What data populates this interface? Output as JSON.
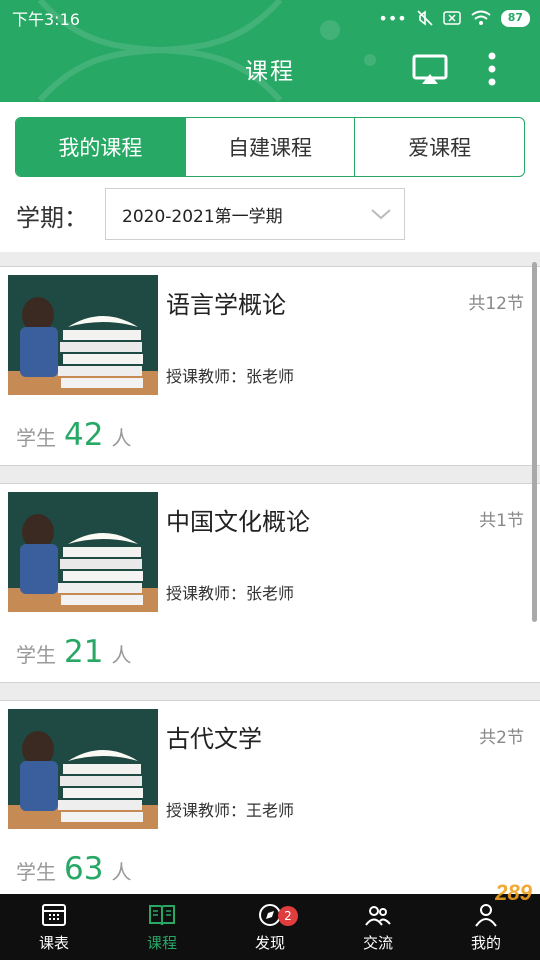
{
  "status_bar": {
    "time": "下午3:16",
    "battery": "87"
  },
  "header": {
    "title": "课程"
  },
  "segments": [
    "我的课程",
    "自建课程",
    "爱课程"
  ],
  "term": {
    "label": "学期：",
    "selected": "2020-2021第一学期"
  },
  "students_label": "学生",
  "students_unit": "人",
  "courses": [
    {
      "name": "语言学概论",
      "sections": "共12节",
      "teacher": "授课教师：张老师",
      "students": "42"
    },
    {
      "name": "中国文化概论",
      "sections": "共1节",
      "teacher": "授课教师：张老师",
      "students": "21"
    },
    {
      "name": "古代文学",
      "sections": "共2节",
      "teacher": "授课教师：王老师",
      "students": "63"
    }
  ],
  "tabs": [
    {
      "label": "课表",
      "icon": "calendar-icon"
    },
    {
      "label": "课程",
      "icon": "book-icon"
    },
    {
      "label": "发现",
      "icon": "compass-icon",
      "badge": "2"
    },
    {
      "label": "交流",
      "icon": "chat-icon"
    },
    {
      "label": "我的",
      "icon": "user-icon"
    }
  ],
  "watermark": "289",
  "colors": {
    "primary": "#27a865",
    "tabbar": "#0f0f0f",
    "badge": "#e03e3e"
  }
}
